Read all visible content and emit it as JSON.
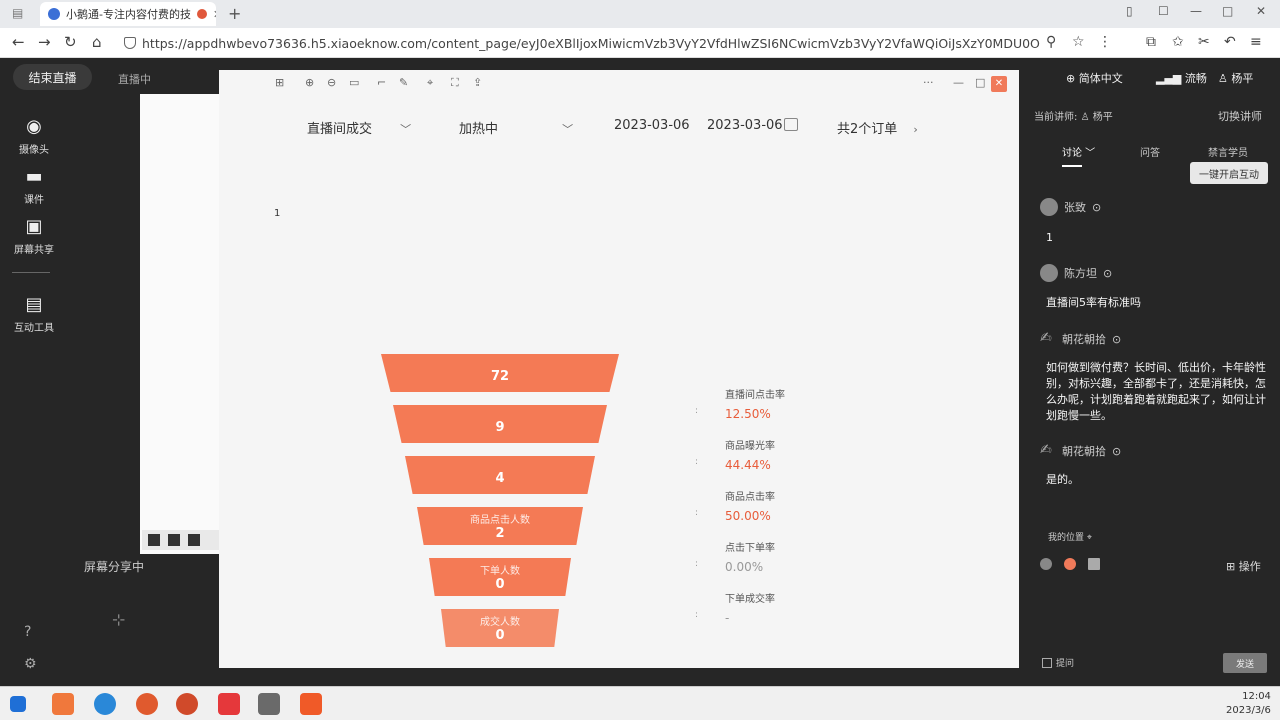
{
  "browser": {
    "tab_title": "小鹅通-专注内容付费的技",
    "url": "https://appdhwbevo73636.h5.xiaoeknow.com/content_page/eyJ0eXBlIjoxMiwicmVzb3VyY2VfdHlwZSI6NCwicmVzb3VyY2VfaWQiOiJsXzY0MDU0ODg2ZTRi"
  },
  "live": {
    "end_button": "结束直播",
    "status": "直播中",
    "left_nav": [
      {
        "label": "摄像头",
        "icon": "camera-icon"
      },
      {
        "label": "课件",
        "icon": "folder-icon"
      },
      {
        "label": "屏幕共享",
        "icon": "screen-share-icon"
      },
      {
        "label": "互动工具",
        "icon": "toolbox-icon"
      }
    ],
    "screen_sharing": "屏幕分享中"
  },
  "popup": {
    "filters": {
      "source": "直播间成交",
      "state": "加热中",
      "date_start": "2023-03-06",
      "date_end": "2023-03-06",
      "orders": "共2个订单"
    },
    "tiny_text": "1",
    "funnel": [
      {
        "value": "72",
        "color": "#f47a55"
      },
      {
        "value": "9",
        "color": "#f47a55"
      },
      {
        "value": "4",
        "color": "#f47a55"
      },
      {
        "label": "商品点击人数",
        "value": "2",
        "color": "#f47a55"
      },
      {
        "label": "下单人数",
        "value": "0",
        "color": "#f47a55"
      },
      {
        "label": "成交人数",
        "value": "0",
        "color": "#f48c6a"
      }
    ],
    "rates": [
      {
        "label": "直播间点击率",
        "value": "12.50%"
      },
      {
        "label": "商品曝光率",
        "value": "44.44%"
      },
      {
        "label": "商品点击率",
        "value": "50.00%"
      },
      {
        "label": "点击下单率",
        "value": "0.00%"
      },
      {
        "label": "下单成交率",
        "value": "-"
      }
    ]
  },
  "chat": {
    "lang": "简体中文",
    "network": "流畅",
    "user": "杨平",
    "lecturer_label": "当前讲师:",
    "lecturer": "杨平",
    "switch": "切换讲师",
    "tabs": [
      "讨论",
      "问答",
      "禁言学员"
    ],
    "interact_button": "一键开启互动",
    "messages": [
      {
        "name": "张致",
        "text": "1"
      },
      {
        "name": "陈方坦",
        "text": "直播间5率有标准吗"
      },
      {
        "name": "朝花朝拾",
        "text": "如何做到微付费？长时间、低出价，卡年龄性别，对标兴趣，全部都卡了，还是消耗快，怎么办呢，计划跑着跑着就跑起来了，如何让计划跑慢一些。"
      },
      {
        "name": "朝花朝拾",
        "text": "是的。"
      }
    ],
    "location": "我的位置",
    "operations": "操作",
    "ask_label": "提问",
    "send": "发送"
  },
  "taskbar": {
    "time": "12:04",
    "date": "2023/3/6"
  }
}
